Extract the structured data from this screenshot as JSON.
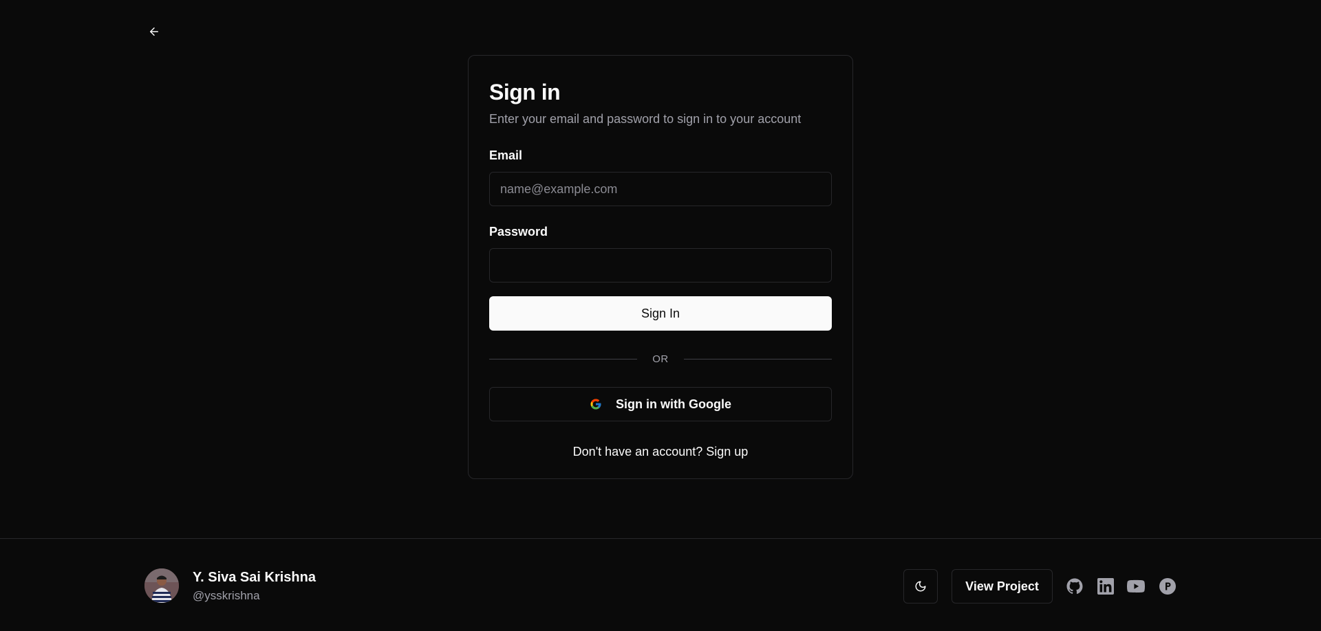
{
  "back": {
    "icon": "arrow-left-icon"
  },
  "signin": {
    "title": "Sign in",
    "subtitle": "Enter your email and password to sign in to your account",
    "email_label": "Email",
    "email_placeholder": "name@example.com",
    "email_value": "",
    "password_label": "Password",
    "password_value": "",
    "submit_label": "Sign In",
    "divider_text": "OR",
    "google_label": "Sign in with Google",
    "signup_prompt": "Don't have an account?",
    "signup_link": "Sign up"
  },
  "footer": {
    "user_name": "Y. Siva Sai Krishna",
    "user_handle": "@ysskrishna",
    "theme_icon": "moon-icon",
    "view_project_label": "View Project",
    "social_icons": [
      "github-icon",
      "linkedin-icon",
      "youtube-icon",
      "producthunt-icon"
    ]
  },
  "colors": {
    "background": "#0a0a0a",
    "border": "#27272a",
    "text": "#fafafa",
    "muted": "#a1a1aa",
    "primary_button": "#fafafa"
  }
}
